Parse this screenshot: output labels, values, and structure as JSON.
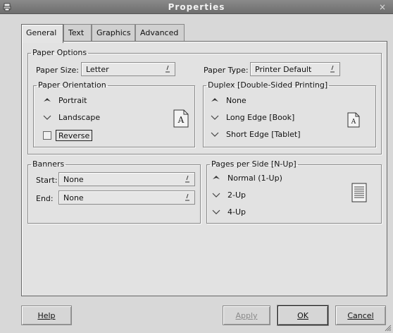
{
  "window": {
    "title": "Properties",
    "close_glyph": "×"
  },
  "tabs": [
    {
      "label": "General",
      "active": true
    },
    {
      "label": "Text",
      "active": false
    },
    {
      "label": "Graphics",
      "active": false
    },
    {
      "label": "Advanced",
      "active": false
    }
  ],
  "paper_options": {
    "legend": "Paper Options",
    "paper_size": {
      "label": "Paper Size:",
      "value": "Letter"
    },
    "paper_type": {
      "label": "Paper Type:",
      "value": "Printer Default"
    },
    "orientation": {
      "legend": "Paper Orientation",
      "options": [
        {
          "label": "Portrait",
          "selected": true
        },
        {
          "label": "Landscape",
          "selected": false
        }
      ],
      "reverse": {
        "label": "Reverse",
        "checked": false
      }
    },
    "duplex": {
      "legend": "Duplex [Double-Sided Printing]",
      "options": [
        {
          "label": "None",
          "selected": true
        },
        {
          "label": "Long Edge [Book]",
          "selected": false
        },
        {
          "label": "Short Edge [Tablet]",
          "selected": false
        }
      ]
    }
  },
  "banners": {
    "legend": "Banners",
    "start": {
      "label": "Start:",
      "value": "None"
    },
    "end": {
      "label": "End:",
      "value": "None"
    }
  },
  "nup": {
    "legend": "Pages per Side [N-Up]",
    "options": [
      {
        "label": "Normal (1-Up)",
        "selected": true
      },
      {
        "label": "2-Up",
        "selected": false
      },
      {
        "label": "4-Up",
        "selected": false
      }
    ]
  },
  "buttons": {
    "help": {
      "label": "Help",
      "mnemonic_index": 0
    },
    "apply": {
      "label": "Apply",
      "disabled": true
    },
    "ok": {
      "label": "OK"
    },
    "cancel": {
      "label": "Cancel"
    }
  },
  "colors": {
    "titlebar": "#7c7c7c",
    "panel": "#e2e2e2",
    "frame_border": "#8a8a8a"
  },
  "icons": {
    "window": "printer-icon",
    "close": "close-icon",
    "combo_arrow": "dropdown-arrow-icon",
    "radio_selected": "diamond-up-icon",
    "radio_unselected": "chevron-down-icon",
    "orientation_preview": "portrait-page-icon",
    "duplex_preview": "duplex-page-icon",
    "nup_preview": "one-up-page-icon"
  }
}
